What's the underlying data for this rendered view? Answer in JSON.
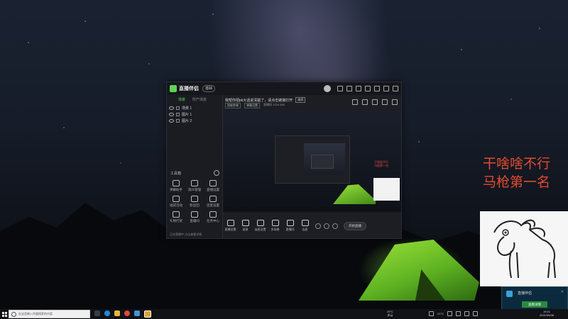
{
  "app": {
    "title": "直播伴侣",
    "badge": "基础",
    "tabs": [
      "场景",
      "所产场景"
    ],
    "scenes": [
      "场景 1",
      "图片 1",
      "图片 2"
    ],
    "toolbox_title": "工具箱",
    "tools": [
      "弹幕助手",
      "观众管理",
      "直播设置",
      "福袋活动",
      "粉丝团",
      "连麦设置",
      "礼物打赏",
      "直播间",
      "任务中心",
      "录屏",
      "设置",
      "其他"
    ],
    "footer_note": "正在直播中 点击查看详情"
  },
  "main": {
    "title": "我帮你把pk大话说清楚了，请点击链接打开",
    "title_badge": "编辑",
    "sub_buttons": [
      "智能剪辑",
      "弹幕设置"
    ],
    "sub_info": "直播间 1234 456",
    "preview_text": [
      "干啥啥不行",
      "马枪第一名"
    ],
    "controls": [
      "直播设置",
      "录屏",
      "连麦设置",
      "多场景",
      "直播间",
      "连麦"
    ],
    "go_live": "开始直播"
  },
  "overlay": {
    "line1": "干啥啥不行",
    "line2": "马枪第一名"
  },
  "notification": {
    "title": "直播伴侣",
    "button": "查看详情",
    "close": "✕"
  },
  "taskbar": {
    "search_placeholder": "在这里输入你要搜索的内容",
    "weather_temp": "29°C",
    "weather_text": "多云",
    "tray_temp": "21°C",
    "time": "19:21",
    "date": "2021/05/06"
  },
  "colors": {
    "accent": "#5fd35a",
    "overlay_text": "#e24b30",
    "notify_btn": "#2a8b3c"
  }
}
